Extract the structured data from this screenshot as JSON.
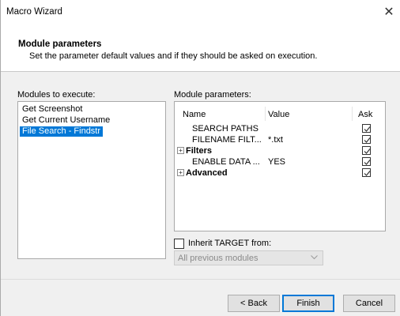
{
  "window": {
    "title": "Macro Wizard",
    "close_glyph": "✕"
  },
  "header": {
    "title": "Module parameters",
    "description": "Set the parameter default values and if they should be asked on execution."
  },
  "modules": {
    "label": "Modules to execute:",
    "items": [
      {
        "label": "Get Screenshot",
        "selected": false
      },
      {
        "label": "Get Current Username",
        "selected": false
      },
      {
        "label": "File Search - Findstr",
        "selected": true
      }
    ],
    "selection_color": "#0078d7"
  },
  "params": {
    "label": "Module parameters:",
    "columns": {
      "name": "Name",
      "value": "Value",
      "ask": "Ask"
    },
    "rows": [
      {
        "name": "SEARCH PATHS",
        "value": "",
        "ask": true,
        "group": false
      },
      {
        "name": "FILENAME FILT...",
        "value": "*.txt",
        "ask": true,
        "group": false
      },
      {
        "name": "Filters",
        "value": "",
        "ask": true,
        "group": true,
        "expander": "+"
      },
      {
        "name": "ENABLE DATA ...",
        "value": "YES",
        "ask": true,
        "group": false
      },
      {
        "name": "Advanced",
        "value": "",
        "ask": true,
        "group": true,
        "expander": "+"
      }
    ]
  },
  "inherit": {
    "label": "Inherit TARGET from:",
    "checked": false,
    "select_value": "All previous modules",
    "select_icon": "chevron-down-icon"
  },
  "footer": {
    "back_label": "< Back",
    "finish_label": "Finish",
    "cancel_label": "Cancel"
  }
}
